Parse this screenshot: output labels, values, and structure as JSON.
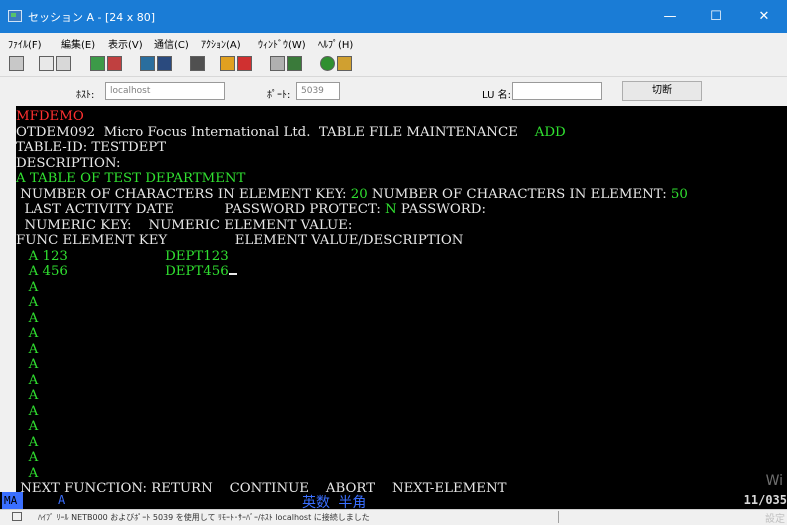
{
  "window": {
    "title": "セッション A - [24 x 80]",
    "minimize": "—",
    "maximize": "☐",
    "close": "✕"
  },
  "menu": [
    "ﾌｧｲﾙ(F)",
    "編集(E)",
    "表示(V)",
    "通信(C)",
    "ｱｸｼｮﾝ(A)",
    "ｳｨﾝﾄﾞｳ(W)",
    "ﾍﾙﾌﾟ(H)"
  ],
  "connection": {
    "host_label": "ﾎｽﾄ:",
    "host_value": "localhost",
    "port_label": "ﾎﾟｰﾄ:",
    "port_value": "5039",
    "lu_label": "LU 名:",
    "lu_value": "",
    "disconnect_label": "切断"
  },
  "terminal": {
    "lines": [
      [
        {
          "t": "MFDEMO",
          "c": "red"
        }
      ],
      [
        {
          "t": "OTDEM092  Micro Focus International Ltd.  TABLE FILE MAINTENANCE    ",
          "c": "wht"
        },
        {
          "t": "ADD",
          "c": "grn"
        }
      ],
      [
        {
          "t": "TABLE-ID: TESTDEPT",
          "c": "wht"
        }
      ],
      [
        {
          "t": "DESCRIPTION:",
          "c": "wht"
        }
      ],
      [
        {
          "t": "A TABLE OF TEST DEPARTMENT",
          "c": "grn"
        }
      ],
      [
        {
          "t": " NUMBER OF CHARACTERS IN ELEMENT KEY: ",
          "c": "wht"
        },
        {
          "t": "20",
          "c": "grn"
        },
        {
          "t": " NUMBER OF CHARACTERS IN ELEMENT: ",
          "c": "wht"
        },
        {
          "t": "50",
          "c": "grn"
        }
      ],
      [
        {
          "t": "  LAST ACTIVITY DATE            PASSWORD PROTECT: ",
          "c": "wht"
        },
        {
          "t": "N",
          "c": "grn"
        },
        {
          "t": " PASSWORD:",
          "c": "wht"
        }
      ],
      [
        {
          "t": "  NUMERIC KEY:    NUMERIC ELEMENT VALUE:",
          "c": "wht"
        }
      ],
      [
        {
          "t": "FUNC ELEMENT KEY                ELEMENT VALUE/DESCRIPTION",
          "c": "wht"
        }
      ],
      [
        {
          "t": "   A ",
          "c": "grn"
        },
        {
          "t": "123",
          "c": "grn"
        },
        {
          "t": "                       DEPT123",
          "c": "grn"
        }
      ],
      [
        {
          "t": "   A ",
          "c": "grn"
        },
        {
          "t": "456",
          "c": "grn"
        },
        {
          "t": "                       DEPT456",
          "c": "grn"
        },
        {
          "t": "_cursor",
          "c": "cursor"
        }
      ],
      [
        {
          "t": "   A",
          "c": "grn"
        }
      ],
      [
        {
          "t": "   A",
          "c": "grn"
        }
      ],
      [
        {
          "t": "   A",
          "c": "grn"
        }
      ],
      [
        {
          "t": "   A",
          "c": "grn"
        }
      ],
      [
        {
          "t": "   A",
          "c": "grn"
        }
      ],
      [
        {
          "t": "   A",
          "c": "grn"
        }
      ],
      [
        {
          "t": "   A",
          "c": "grn"
        }
      ],
      [
        {
          "t": "   A",
          "c": "grn"
        }
      ],
      [
        {
          "t": "   A",
          "c": "grn"
        }
      ],
      [
        {
          "t": "   A",
          "c": "grn"
        }
      ],
      [
        {
          "t": "   A",
          "c": "grn"
        }
      ],
      [
        {
          "t": "   A",
          "c": "grn"
        }
      ],
      [
        {
          "t": "   A",
          "c": "grn"
        }
      ],
      [
        {
          "t": " NEXT FUNCTION: RETURN    CONTINUE    ABORT    NEXT-ELEMENT",
          "c": "wht"
        }
      ]
    ]
  },
  "oia": {
    "indicator": "MA",
    "mode": "A",
    "input_mode": "英数 半角",
    "cursor_pos": "11/035"
  },
  "statusbar": {
    "message": "ﾊｲﾌﾞ ﾘｰﾙ NETB000 およびﾎﾟｰﾄ 5039 を使用して ﾘﾓｰﾄ･ｻｰﾊﾞｰ/ﾎｽﾄ localhost に接続しました"
  },
  "watermark": {
    "line1": "Wi",
    "line2": "設定"
  }
}
